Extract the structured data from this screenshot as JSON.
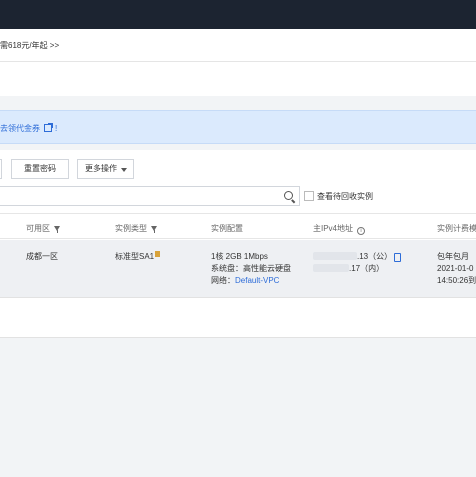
{
  "promo": {
    "text": "需618元/年起 >>"
  },
  "notice": {
    "link_text": "去领代金券",
    "bang": "!"
  },
  "toolbar": {
    "reset_password": "重置密码",
    "more_actions": "更多操作"
  },
  "search": {
    "placeholder": "",
    "recycle_label": "查看待回收实例"
  },
  "table": {
    "headers": {
      "zone": "可用区",
      "instance_type": "实例类型",
      "config": "实例配置",
      "ipv4": "主IPv4地址",
      "billing": "实例计费模"
    },
    "rows": [
      {
        "zone": "成都一区",
        "instance_type": "标准型SA1",
        "config_line1": "1核 2GB 1Mbps",
        "config_line2": "系统盘：高性能云硬盘",
        "network_label": "网络：",
        "network_value": "Default-VPC",
        "ip_public_suffix": ".13（公）",
        "ip_private_suffix": ".17（内）",
        "billing_line1": "包年包月",
        "billing_line2": "2021-01-0",
        "billing_line3": "14:50:26到"
      }
    ]
  },
  "colors": {
    "accent": "#2d6cd8",
    "topbar": "#1c2431",
    "notice_bg": "#dbeafd",
    "row_bg": "#eef0f3"
  }
}
